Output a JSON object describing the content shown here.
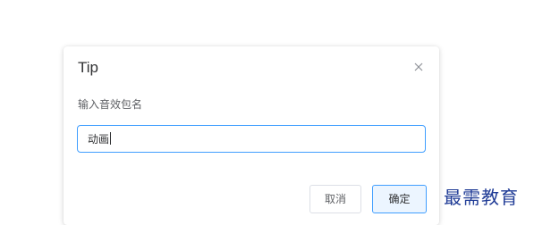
{
  "dialog": {
    "title": "Tip",
    "message": "输入音效包名",
    "input_value": "动画",
    "close_icon": "close-icon"
  },
  "buttons": {
    "cancel_label": "取消",
    "confirm_label": "确定"
  },
  "watermark": {
    "text": "最需教育"
  },
  "colors": {
    "accent": "#409eff",
    "watermark": "#1f3b96"
  }
}
